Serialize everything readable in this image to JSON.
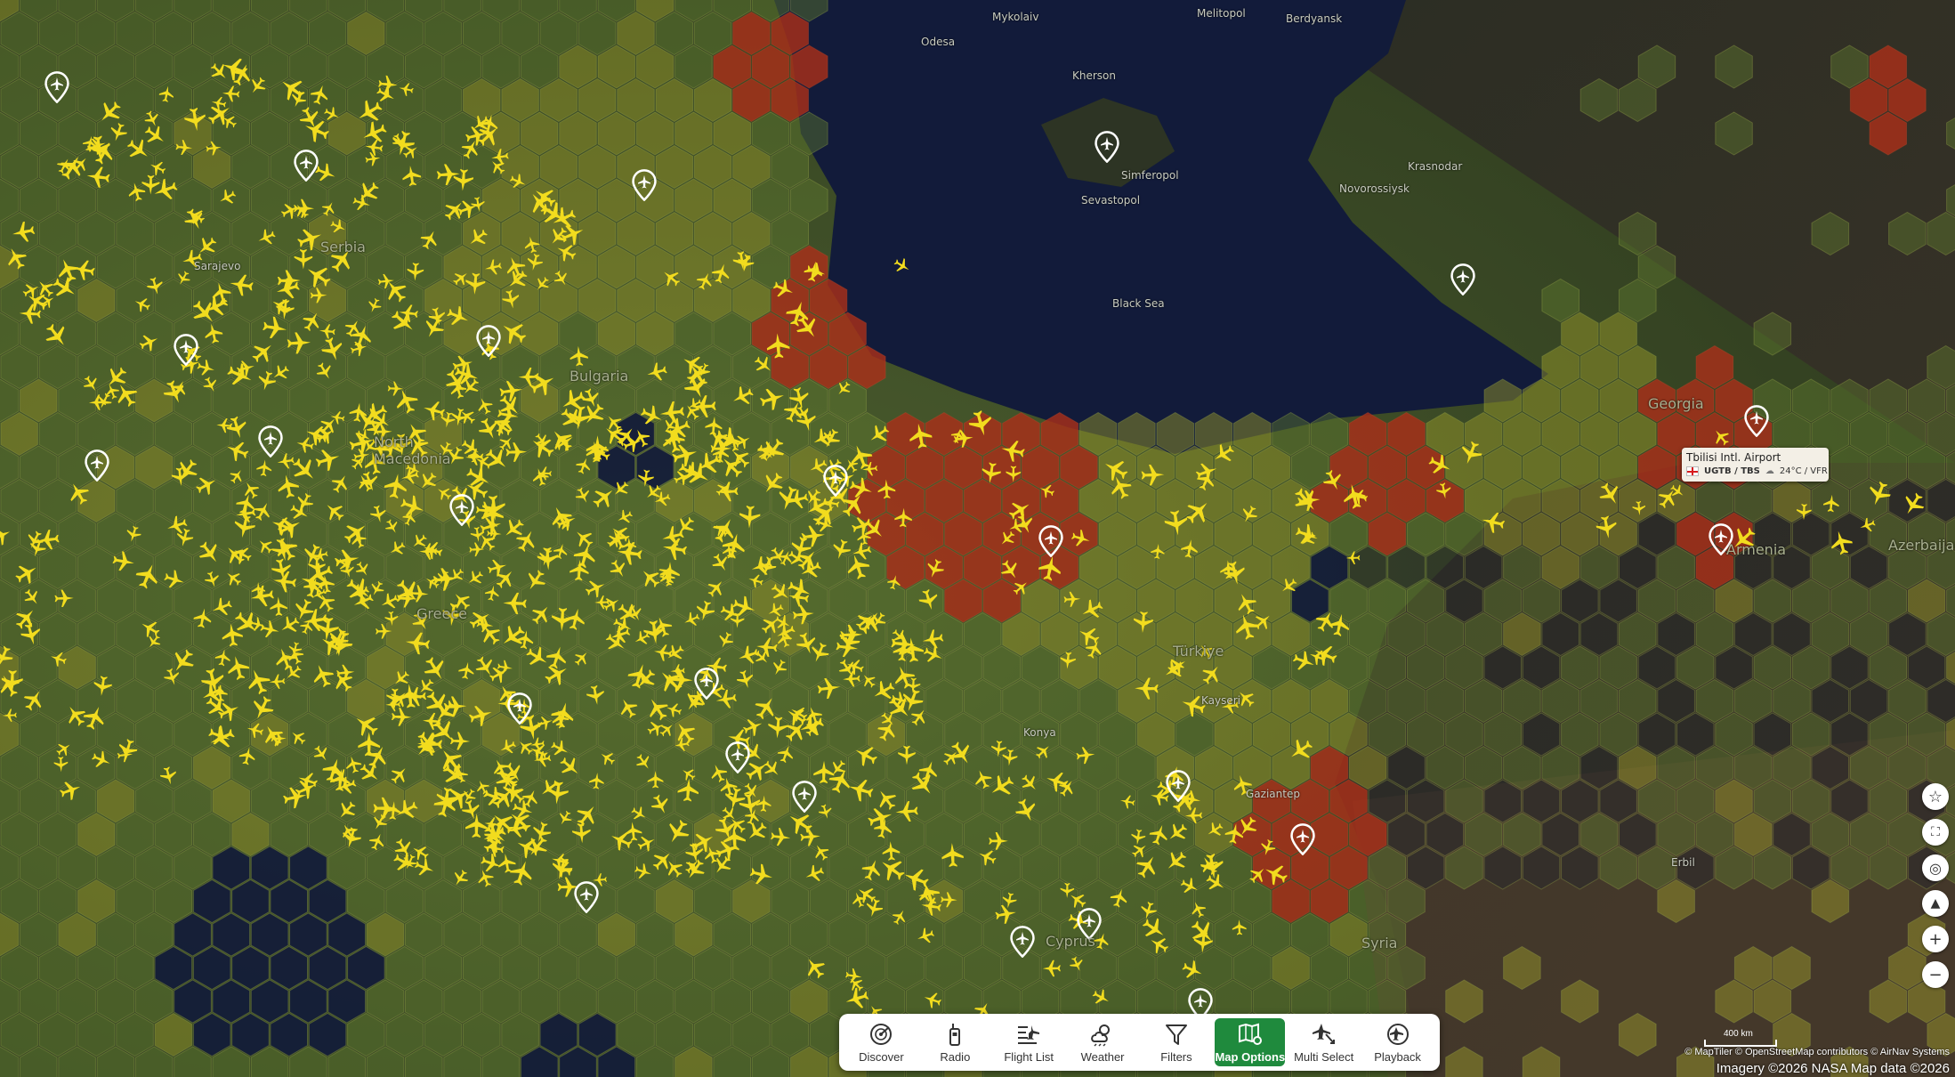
{
  "map": {
    "labels": {
      "countries": [
        "Bulgaria",
        "North Macedonia",
        "Türkiye",
        "Georgia",
        "Armenia",
        "Azerbaijan",
        "Syria",
        "Greece",
        "Serbia",
        "Cyprus"
      ],
      "cities": [
        "Odesa",
        "Mykolaiv",
        "Melitopol",
        "Berdyansk",
        "Kherson",
        "Simferopol",
        "Sevastopol",
        "Krasnodar",
        "Novorossiysk",
        "Sarajevo",
        "Gaziantep",
        "Erbil",
        "Kayseri",
        "Konya",
        "Black Sea"
      ]
    },
    "colors": {
      "land": "#3a4a28",
      "sea": "#121b3a",
      "hex_green": "#5f7a2e",
      "hex_yellow": "#9fa02a",
      "hex_red": "#a8301a",
      "hex_dark": "#23262a",
      "plane": "#f2dc1e"
    }
  },
  "airport_tooltip": {
    "name": "Tbilisi Intl. Airport",
    "codes": "UGTB / TBS",
    "weather": "24°C / VFR"
  },
  "toolbar": {
    "buttons": [
      {
        "label": "Discover",
        "icon": "radar-icon"
      },
      {
        "label": "Radio",
        "icon": "radio-icon"
      },
      {
        "label": "Flight List",
        "icon": "flight-list-icon"
      },
      {
        "label": "Weather",
        "icon": "weather-icon"
      },
      {
        "label": "Filters",
        "icon": "filter-icon"
      },
      {
        "label": "Map Options",
        "icon": "map-options-icon",
        "active": true
      },
      {
        "label": "Multi Select",
        "icon": "multi-select-icon"
      },
      {
        "label": "Playback",
        "icon": "playback-icon"
      }
    ]
  },
  "side_controls": [
    {
      "icon": "star-icon"
    },
    {
      "icon": "fullscreen-icon"
    },
    {
      "icon": "locate-icon"
    },
    {
      "icon": "compass-icon"
    },
    {
      "icon": "zoom-in-icon",
      "glyph": "+"
    },
    {
      "icon": "zoom-out-icon",
      "glyph": "−"
    }
  ],
  "scale": "400 km",
  "attribution": "© MapTiler © OpenStreetMap contributors © AirNav Systems",
  "imagery": "Imagery ©2026 NASA Map data ©2026"
}
